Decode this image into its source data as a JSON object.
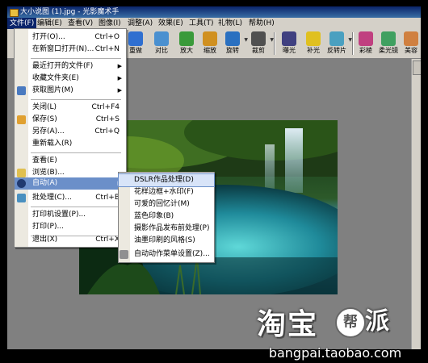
{
  "window": {
    "title": "大小说图 (1).jpg - 光影魔术手"
  },
  "menubar": [
    {
      "label": "文件(F)",
      "active": true
    },
    {
      "label": "编辑(E)"
    },
    {
      "label": "查看(V)"
    },
    {
      "label": "图像(I)"
    },
    {
      "label": "调整(A)"
    },
    {
      "label": "效果(E)"
    },
    {
      "label": "工具(T)"
    },
    {
      "label": "礼物(L)"
    },
    {
      "label": "帮助(H)"
    }
  ],
  "toolbar": [
    {
      "label": "重做",
      "color": "#2f6fd0"
    },
    {
      "label": "对比",
      "color": "#4a90d0"
    },
    {
      "label": "放大",
      "color": "#3a9a3a"
    },
    {
      "label": "缩放",
      "color": "#d09020"
    },
    {
      "label": "旋转",
      "color": "#2a70c0"
    },
    {
      "label": "裁剪",
      "color": "#505050"
    },
    {
      "label": "曝光",
      "color": "#404080"
    },
    {
      "label": "补光",
      "color": "#e0c020"
    },
    {
      "label": "反转片",
      "color": "#4aa0c0"
    },
    {
      "label": "彩棱",
      "color": "#c04080"
    },
    {
      "label": "柔光镜",
      "color": "#40a060"
    },
    {
      "label": "美容",
      "color": "#d08040"
    }
  ],
  "file_menu": {
    "items": [
      {
        "label": "打开(O)...",
        "shortcut": "Ctrl+O"
      },
      {
        "label": "在新窗口打开(N)...",
        "shortcut": "Ctrl+N"
      },
      {
        "label": "最近打开的文件(F)",
        "submenu": true
      },
      {
        "label": "收藏文件夹(E)",
        "submenu": true
      },
      {
        "label": "获取图片(M)",
        "submenu": true
      },
      {
        "label": "关闭(L)",
        "shortcut": "Ctrl+F4"
      },
      {
        "label": "保存(S)",
        "shortcut": "Ctrl+S"
      },
      {
        "label": "另存(A)...",
        "shortcut": "Ctrl+Q"
      },
      {
        "label": "重新载入(R)"
      },
      {
        "label": "查看(E)"
      },
      {
        "label": "浏览(B)..."
      },
      {
        "label": "自动(A)",
        "submenu": true
      },
      {
        "label": "批处理(C)...",
        "shortcut": "Ctrl+B"
      },
      {
        "label": "打印机设置(P)..."
      },
      {
        "label": "打印(P)..."
      },
      {
        "label": "退出(X)",
        "shortcut": "Ctrl+X"
      }
    ]
  },
  "auto_submenu": {
    "items": [
      {
        "label": "DSLR作品处理(D)"
      },
      {
        "label": "花样边框+水印(F)"
      },
      {
        "label": "可爱的回忆计(M)"
      },
      {
        "label": "蓝色印象(B)"
      },
      {
        "label": "摄影作品发布前处理(P)"
      },
      {
        "label": "油墨印刷的风格(S)"
      },
      {
        "label": "自动动作菜单设置(Z)..."
      }
    ]
  },
  "watermark": {
    "logo": "淘宝",
    "badge": "帮",
    "suffix": "派",
    "url": "bangpai.taobao.com"
  }
}
